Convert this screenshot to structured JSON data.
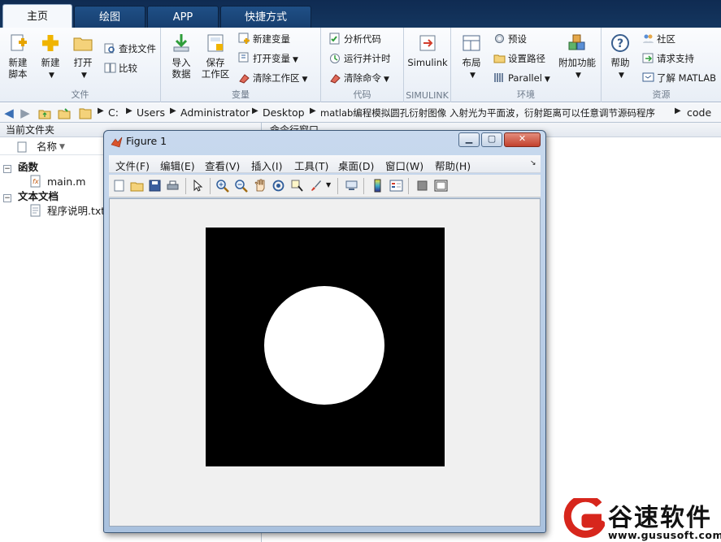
{
  "tabs": [
    "主页",
    "绘图",
    "APP",
    "快捷方式"
  ],
  "ribbon": {
    "file": {
      "group_label": "文件",
      "new_script": "新建\n脚本",
      "new": "新建",
      "open": "打开",
      "find_files": "查找文件",
      "compare": "比较"
    },
    "variable": {
      "group_label": "变量",
      "import_data": "导入\n数据",
      "save_workspace": "保存\n工作区",
      "new_variable": "新建变量",
      "open_variable": "打开变量",
      "clear_workspace": "清除工作区"
    },
    "code": {
      "group_label": "代码",
      "analyze_code": "分析代码",
      "run_and_time": "运行并计时",
      "clear_commands": "清除命令"
    },
    "simulink": {
      "group_label": "SIMULINK",
      "simulink": "Simulink"
    },
    "environment": {
      "group_label": "环境",
      "layout": "布局",
      "preferences": "预设",
      "set_path": "设置路径",
      "parallel": "Parallel",
      "add_ons": "附加功能"
    },
    "resources": {
      "group_label": "资源",
      "help": "帮助",
      "community": "社区",
      "request_support": "请求支持",
      "learn_matlab": "了解 MATLAB"
    }
  },
  "address": {
    "segments": [
      "C:",
      "Users",
      "Administrator",
      "Desktop",
      "matlab编程模拟圆孔衍射图像 入射光为平面波，衍射距离可以任意调节源码程序",
      "code"
    ]
  },
  "current_folder": {
    "title": "当前文件夹",
    "column_name": "名称",
    "groups": [
      {
        "label": "函数",
        "items": [
          "main.m"
        ]
      },
      {
        "label": "文本文档",
        "items": [
          "程序说明.txt"
        ]
      }
    ]
  },
  "command_window": {
    "title": "命令行窗口"
  },
  "figure": {
    "title": "Figure 1",
    "menus": [
      "文件(F)",
      "编辑(E)",
      "查看(V)",
      "插入(I)",
      "工具(T)",
      "桌面(D)",
      "窗口(W)",
      "帮助(H)"
    ],
    "toolbar_icons": [
      "new-figure-icon",
      "open-file-icon",
      "save-icon",
      "print-icon",
      "pointer-icon",
      "zoom-in-icon",
      "zoom-out-icon",
      "pan-icon",
      "rotate-3d-icon",
      "data-cursor-icon",
      "brush-icon",
      "link-icon",
      "colorbar-icon",
      "legend-icon",
      "hide-plot-tools-icon",
      "show-plot-tools-icon"
    ]
  },
  "watermark": {
    "brand": "谷速软件",
    "url": "www.gususoft.com"
  },
  "colors": {
    "tab_bar": "#14365f",
    "ribbon": "#eef2f8",
    "accent": "#3a6fb5",
    "watermark_red": "#d7261c"
  }
}
